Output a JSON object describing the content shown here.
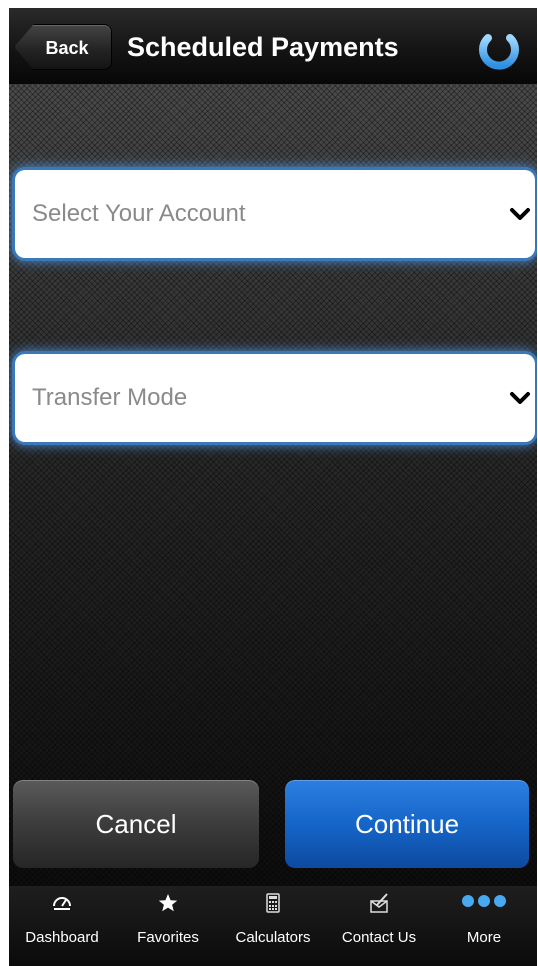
{
  "header": {
    "back_label": "Back",
    "title": "Scheduled Payments",
    "power_icon": "power-icon"
  },
  "form": {
    "account_select": {
      "placeholder": "Select Your Account",
      "icon": "chevron-down-icon"
    },
    "transfer_mode_select": {
      "placeholder": "Transfer Mode",
      "icon": "chevron-down-icon"
    }
  },
  "actions": {
    "cancel_label": "Cancel",
    "continue_label": "Continue"
  },
  "tabbar": {
    "items": [
      {
        "label": "Dashboard",
        "icon": "dashboard-icon"
      },
      {
        "label": "Favorites",
        "icon": "star-icon"
      },
      {
        "label": "Calculators",
        "icon": "calculator-icon"
      },
      {
        "label": "Contact Us",
        "icon": "contact-icon"
      },
      {
        "label": "More",
        "icon": "more-dots-icon"
      }
    ]
  },
  "colors": {
    "accent_blue": "#1565c8",
    "select_glow": "#3a78b8",
    "power_icon_blue": "#3aa0e8"
  }
}
